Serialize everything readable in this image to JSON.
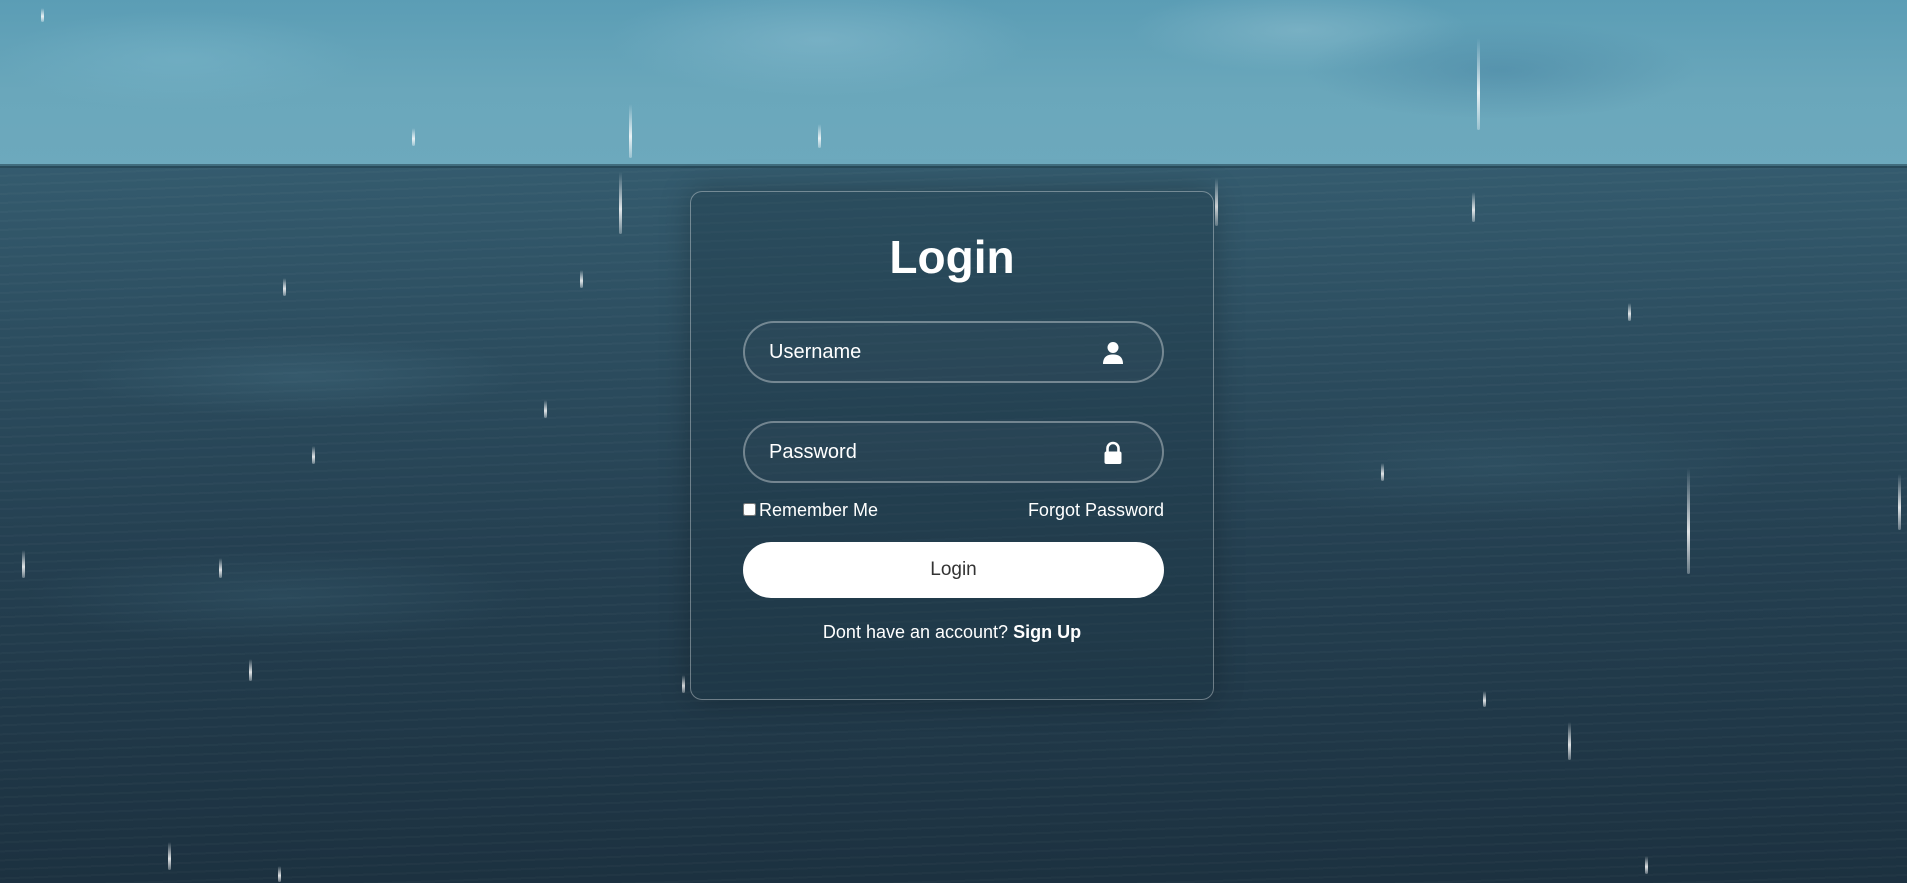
{
  "form": {
    "title": "Login",
    "username_placeholder": "Username",
    "password_placeholder": "Password",
    "remember_label": "Remember Me",
    "forgot_label": "Forgot Password",
    "login_button": "Login",
    "signup_prompt": "Dont have an account?",
    "signup_link": "Sign Up",
    "username_icon": "user-icon",
    "password_icon": "lock-icon"
  },
  "colors": {
    "sky": "#6aa7bb",
    "sea": "#243f50",
    "button_bg": "#ffffff",
    "button_text": "#333333"
  }
}
